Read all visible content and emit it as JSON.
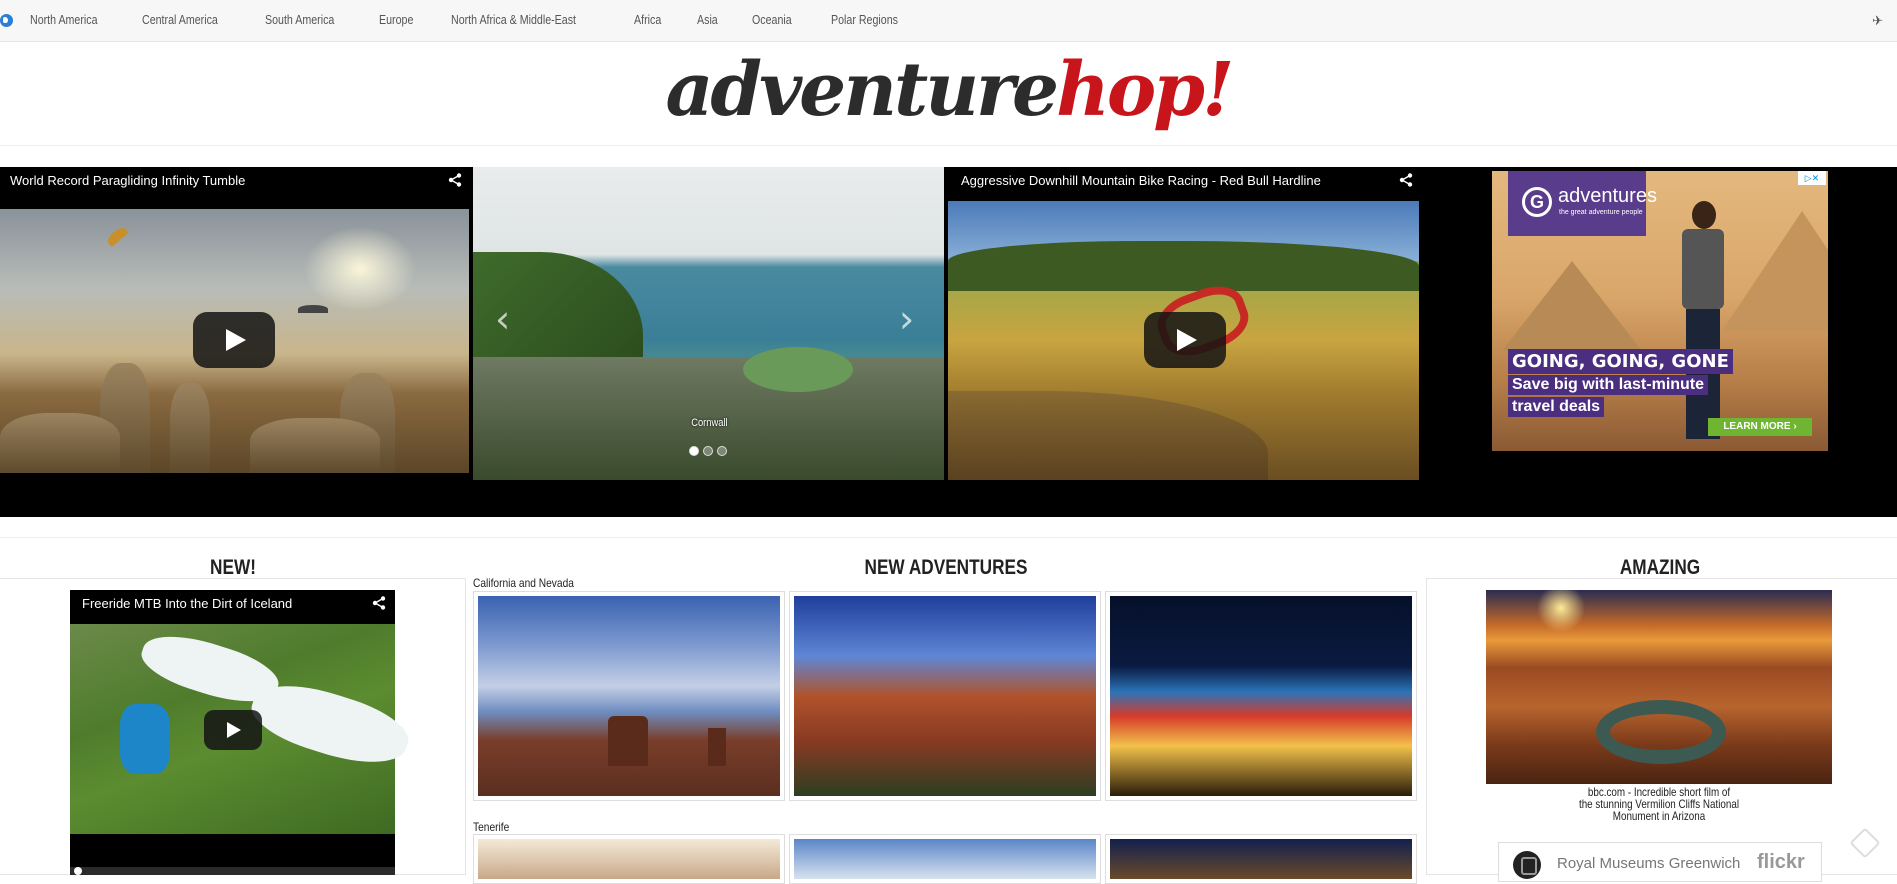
{
  "nav": {
    "items": [
      "North America",
      "Central America",
      "South America",
      "Europe",
      "North Africa & Middle-East",
      "Africa",
      "Asia",
      "Oceania",
      "Polar Regions"
    ]
  },
  "logo": {
    "part1": "adventure",
    "part2": "hop!"
  },
  "hero": {
    "video1_title": "World Record Paragliding Infinity Tumble",
    "slider_caption": "Cornwall",
    "video2_title": "Aggressive Downhill Mountain Bike Racing - Red Bull Hardline"
  },
  "ad": {
    "brand": "adventures",
    "tagline": "the great adventure people",
    "headline": "GOING, GOING, GONE",
    "line1": "Save big with last-minute",
    "line2": "travel deals",
    "button": "LEARN MORE ›"
  },
  "sections": {
    "new_title": "NEW!",
    "new_video_title": "Freeride MTB Into the Dirt of Iceland",
    "adventures_title": "NEW ADVENTURES",
    "group1_label": "California and Nevada",
    "group2_label": "Tenerife",
    "amazing_title": "AMAZING",
    "amazing_caption_1": "bbc.com - Incredible short film of",
    "amazing_caption_2": "the stunning Vermilion Cliffs National",
    "amazing_caption_3": "Monument in Arizona",
    "flickr_name": "Royal Museums Greenwich",
    "flickr_logo": "flickr"
  },
  "colors": {
    "brand_red": "#c8141b",
    "ad_purple": "#4b2e80",
    "ad_green": "#6fb532"
  }
}
